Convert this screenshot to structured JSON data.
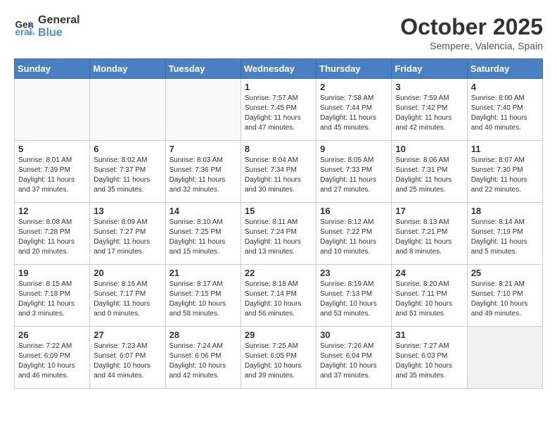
{
  "header": {
    "logo_line1": "General",
    "logo_line2": "Blue",
    "month": "October 2025",
    "location": "Sempere, Valencia, Spain"
  },
  "weekdays": [
    "Sunday",
    "Monday",
    "Tuesday",
    "Wednesday",
    "Thursday",
    "Friday",
    "Saturday"
  ],
  "weeks": [
    [
      {
        "day": "",
        "info": ""
      },
      {
        "day": "",
        "info": ""
      },
      {
        "day": "",
        "info": ""
      },
      {
        "day": "1",
        "info": "Sunrise: 7:57 AM\nSunset: 7:45 PM\nDaylight: 11 hours\nand 47 minutes."
      },
      {
        "day": "2",
        "info": "Sunrise: 7:58 AM\nSunset: 7:44 PM\nDaylight: 11 hours\nand 45 minutes."
      },
      {
        "day": "3",
        "info": "Sunrise: 7:59 AM\nSunset: 7:42 PM\nDaylight: 11 hours\nand 42 minutes."
      },
      {
        "day": "4",
        "info": "Sunrise: 8:00 AM\nSunset: 7:40 PM\nDaylight: 11 hours\nand 40 minutes."
      }
    ],
    [
      {
        "day": "5",
        "info": "Sunrise: 8:01 AM\nSunset: 7:39 PM\nDaylight: 11 hours\nand 37 minutes."
      },
      {
        "day": "6",
        "info": "Sunrise: 8:02 AM\nSunset: 7:37 PM\nDaylight: 11 hours\nand 35 minutes."
      },
      {
        "day": "7",
        "info": "Sunrise: 8:03 AM\nSunset: 7:36 PM\nDaylight: 11 hours\nand 32 minutes."
      },
      {
        "day": "8",
        "info": "Sunrise: 8:04 AM\nSunset: 7:34 PM\nDaylight: 11 hours\nand 30 minutes."
      },
      {
        "day": "9",
        "info": "Sunrise: 8:05 AM\nSunset: 7:33 PM\nDaylight: 11 hours\nand 27 minutes."
      },
      {
        "day": "10",
        "info": "Sunrise: 8:06 AM\nSunset: 7:31 PM\nDaylight: 11 hours\nand 25 minutes."
      },
      {
        "day": "11",
        "info": "Sunrise: 8:07 AM\nSunset: 7:30 PM\nDaylight: 11 hours\nand 22 minutes."
      }
    ],
    [
      {
        "day": "12",
        "info": "Sunrise: 8:08 AM\nSunset: 7:28 PM\nDaylight: 11 hours\nand 20 minutes."
      },
      {
        "day": "13",
        "info": "Sunrise: 8:09 AM\nSunset: 7:27 PM\nDaylight: 11 hours\nand 17 minutes."
      },
      {
        "day": "14",
        "info": "Sunrise: 8:10 AM\nSunset: 7:25 PM\nDaylight: 11 hours\nand 15 minutes."
      },
      {
        "day": "15",
        "info": "Sunrise: 8:11 AM\nSunset: 7:24 PM\nDaylight: 11 hours\nand 13 minutes."
      },
      {
        "day": "16",
        "info": "Sunrise: 8:12 AM\nSunset: 7:22 PM\nDaylight: 11 hours\nand 10 minutes."
      },
      {
        "day": "17",
        "info": "Sunrise: 8:13 AM\nSunset: 7:21 PM\nDaylight: 11 hours\nand 8 minutes."
      },
      {
        "day": "18",
        "info": "Sunrise: 8:14 AM\nSunset: 7:19 PM\nDaylight: 11 hours\nand 5 minutes."
      }
    ],
    [
      {
        "day": "19",
        "info": "Sunrise: 8:15 AM\nSunset: 7:18 PM\nDaylight: 11 hours\nand 3 minutes."
      },
      {
        "day": "20",
        "info": "Sunrise: 8:16 AM\nSunset: 7:17 PM\nDaylight: 11 hours\nand 0 minutes."
      },
      {
        "day": "21",
        "info": "Sunrise: 8:17 AM\nSunset: 7:15 PM\nDaylight: 10 hours\nand 58 minutes."
      },
      {
        "day": "22",
        "info": "Sunrise: 8:18 AM\nSunset: 7:14 PM\nDaylight: 10 hours\nand 56 minutes."
      },
      {
        "day": "23",
        "info": "Sunrise: 8:19 AM\nSunset: 7:13 PM\nDaylight: 10 hours\nand 53 minutes."
      },
      {
        "day": "24",
        "info": "Sunrise: 8:20 AM\nSunset: 7:11 PM\nDaylight: 10 hours\nand 51 minutes."
      },
      {
        "day": "25",
        "info": "Sunrise: 8:21 AM\nSunset: 7:10 PM\nDaylight: 10 hours\nand 49 minutes."
      }
    ],
    [
      {
        "day": "26",
        "info": "Sunrise: 7:22 AM\nSunset: 6:09 PM\nDaylight: 10 hours\nand 46 minutes."
      },
      {
        "day": "27",
        "info": "Sunrise: 7:23 AM\nSunset: 6:07 PM\nDaylight: 10 hours\nand 44 minutes."
      },
      {
        "day": "28",
        "info": "Sunrise: 7:24 AM\nSunset: 6:06 PM\nDaylight: 10 hours\nand 42 minutes."
      },
      {
        "day": "29",
        "info": "Sunrise: 7:25 AM\nSunset: 6:05 PM\nDaylight: 10 hours\nand 39 minutes."
      },
      {
        "day": "30",
        "info": "Sunrise: 7:26 AM\nSunset: 6:04 PM\nDaylight: 10 hours\nand 37 minutes."
      },
      {
        "day": "31",
        "info": "Sunrise: 7:27 AM\nSunset: 6:03 PM\nDaylight: 10 hours\nand 35 minutes."
      },
      {
        "day": "",
        "info": ""
      }
    ]
  ]
}
